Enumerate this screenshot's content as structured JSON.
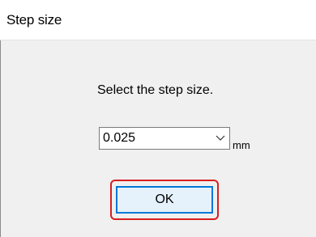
{
  "dialog": {
    "title": "Step size"
  },
  "main": {
    "prompt": "Select the step size.",
    "step_select": {
      "value": "0.025",
      "unit": "mm"
    },
    "ok_label": "OK"
  },
  "colors": {
    "highlight": "#d81e1e",
    "button_border": "#0078d7",
    "button_fill": "#e5f1fb"
  },
  "icons": {
    "dropdown": "chevron-down-icon"
  }
}
